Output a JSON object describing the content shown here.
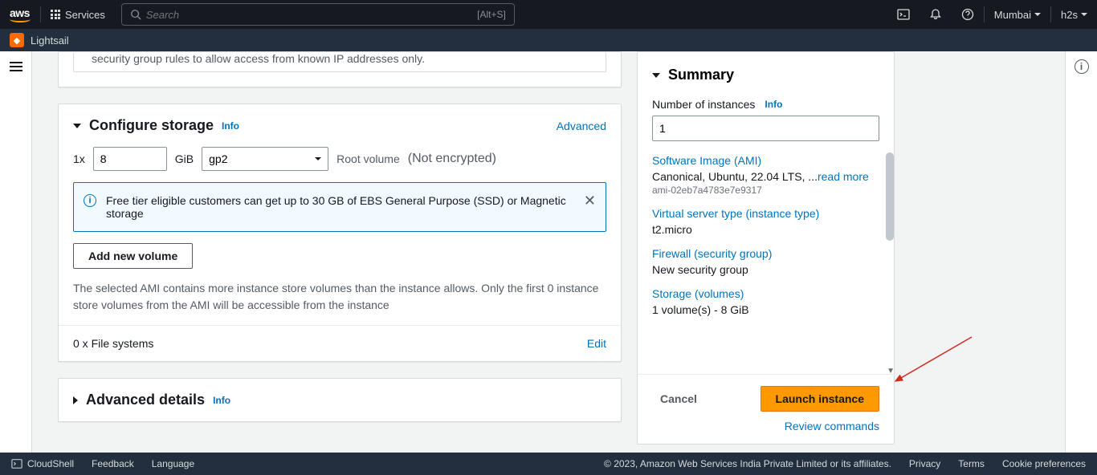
{
  "nav": {
    "services": "Services",
    "search_placeholder": "Search",
    "search_kbd": "[Alt+S]",
    "region": "Mumbai",
    "account": "h2s"
  },
  "subnav": {
    "lightsail": "Lightsail"
  },
  "truncated_security_text": "security group rules to allow access from known IP addresses only.",
  "storage": {
    "title": "Configure storage",
    "info": "Info",
    "advanced": "Advanced",
    "multiplier": "1x",
    "size": "8",
    "unit": "GiB",
    "volume_type": "gp2",
    "root_label": "Root volume",
    "encrypted": "(Not encrypted)",
    "free_tier": "Free tier eligible customers can get up to 30 GB of EBS General Purpose (SSD) or Magnetic storage",
    "add_volume": "Add new volume",
    "ami_note": "The selected AMI contains more instance store volumes than the instance allows. Only the first 0 instance store volumes from the AMI will be accessible from the instance",
    "filesystems": "0 x File systems",
    "edit": "Edit"
  },
  "advanced": {
    "title": "Advanced details",
    "info": "Info"
  },
  "summary": {
    "title": "Summary",
    "num_label": "Number of instances",
    "info": "Info",
    "num_value": "1",
    "ami_link": "Software Image (AMI)",
    "ami_text": "Canonical, Ubuntu, 22.04 LTS, ...",
    "read_more": "read more",
    "ami_id": "ami-02eb7a4783e7e9317",
    "type_link": "Virtual server type (instance type)",
    "type_value": "t2.micro",
    "firewall_link": "Firewall (security group)",
    "firewall_value": "New security group",
    "storage_link": "Storage (volumes)",
    "storage_value": "1 volume(s) - 8 GiB",
    "cancel": "Cancel",
    "launch": "Launch instance",
    "review": "Review commands"
  },
  "footer": {
    "cloudshell": "CloudShell",
    "feedback": "Feedback",
    "language": "Language",
    "copyright": "© 2023, Amazon Web Services India Private Limited or its affiliates.",
    "privacy": "Privacy",
    "terms": "Terms",
    "cookies": "Cookie preferences"
  }
}
